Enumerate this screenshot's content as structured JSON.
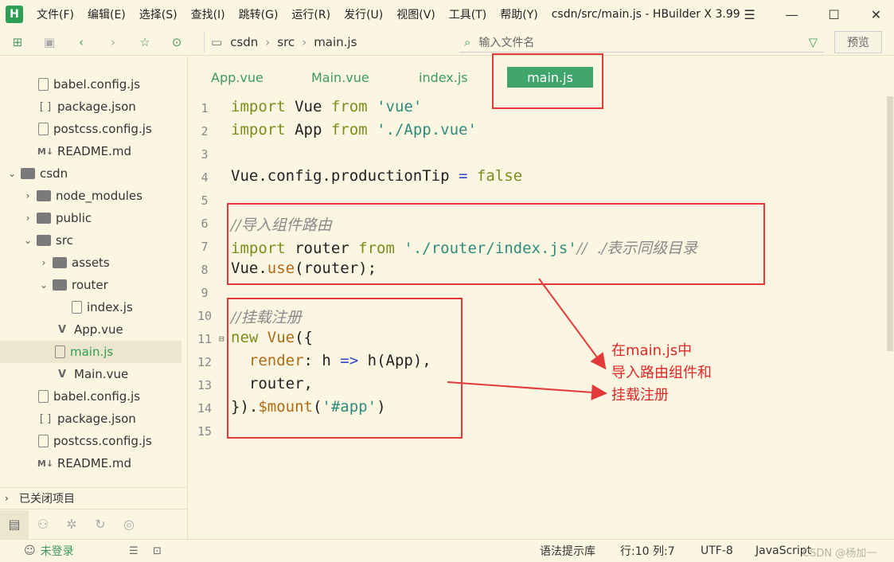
{
  "app": {
    "logo": "H",
    "title": "csdn/src/main.js - HBuilder X 3.99",
    "menu": [
      "文件(F)",
      "编辑(E)",
      "选择(S)",
      "查找(I)",
      "跳转(G)",
      "运行(R)",
      "发行(U)",
      "视图(V)",
      "工具(T)",
      "帮助(Y)"
    ],
    "window_buttons": [
      "☰",
      "—",
      "☐",
      "✕"
    ]
  },
  "toolbar": {
    "breadcrumb": [
      "csdn",
      "src",
      "main.js"
    ],
    "search_placeholder": "输入文件名",
    "preview_label": "预览"
  },
  "sidebar": {
    "items": [
      {
        "label": "babel.config.js",
        "icon": "file-js-icon"
      },
      {
        "label": "package.json",
        "icon": "json-icon"
      },
      {
        "label": "postcss.config.js",
        "icon": "file-js-icon"
      },
      {
        "label": "README.md",
        "icon": "markdown-icon"
      },
      {
        "label": "csdn",
        "icon": "folder-icon"
      },
      {
        "label": "node_modules",
        "icon": "folder-icon"
      },
      {
        "label": "public",
        "icon": "folder-icon"
      },
      {
        "label": "src",
        "icon": "folder-icon"
      },
      {
        "label": "assets",
        "icon": "folder-icon"
      },
      {
        "label": "router",
        "icon": "folder-icon"
      },
      {
        "label": "index.js",
        "icon": "file-js-icon"
      },
      {
        "label": "App.vue",
        "icon": "vue-icon"
      },
      {
        "label": "main.js",
        "icon": "file-js-icon",
        "active": true
      },
      {
        "label": "Main.vue",
        "icon": "vue-icon"
      },
      {
        "label": "babel.config.js",
        "icon": "file-js-icon"
      },
      {
        "label": "package.json",
        "icon": "json-icon"
      },
      {
        "label": "postcss.config.js",
        "icon": "file-js-icon"
      },
      {
        "label": "README.md",
        "icon": "markdown-icon"
      }
    ],
    "closed_projects": "已关闭项目"
  },
  "editor": {
    "tabs": [
      "App.vue",
      "Main.vue",
      "index.js",
      "main.js"
    ],
    "active_tab": "main.js",
    "line_numbers": [
      "1",
      "2",
      "3",
      "4",
      "5",
      "6",
      "7",
      "8",
      "9",
      "10",
      "11",
      "12",
      "13",
      "14",
      "15"
    ],
    "code": {
      "l1_kw": "import",
      "l1_a": " Vue ",
      "l1_from": "from",
      "l1_str": "'vue'",
      "l2_kw": "import",
      "l2_a": " App ",
      "l2_from": "from",
      "l2_str": "'./App.vue'",
      "l4_a": "Vue.config.productionTip ",
      "l4_op": "=",
      "l4_val": "false",
      "l6_cm": "//导入组件路由",
      "l7_kw": "import",
      "l7_a": " router ",
      "l7_from": "from",
      "l7_str": "'./router/index.js'",
      "l7_cm": "//  ./表示同级目录",
      "l8_a": "Vue.",
      "l8_fn": "use",
      "l8_b": "(router);",
      "l10_cm": "//挂载注册",
      "l11_kw": "new",
      "l11_fn": "Vue",
      "l11_b": "({",
      "l12_fn": "render",
      "l12_a": ": h ",
      "l12_op": "=>",
      "l12_b": " h(App),",
      "l13_a": "  router,",
      "l14_a": "}).",
      "l14_fn": "$mount",
      "l14_b": "(",
      "l14_str": "'#app'",
      "l14_c": ")"
    },
    "annotation": [
      "在main.js中",
      "导入路由组件和",
      "挂载注册"
    ]
  },
  "status": {
    "login": "未登录",
    "syntax_lib": "语法提示库",
    "position": "行:10  列:7",
    "encoding": "UTF-8",
    "language": "JavaScript",
    "watermark": "CSDN @杨加一"
  },
  "colors": {
    "background": "#fbf6e2",
    "accent_green": "#3fa56a",
    "annotation_red": "#e23a3a"
  }
}
